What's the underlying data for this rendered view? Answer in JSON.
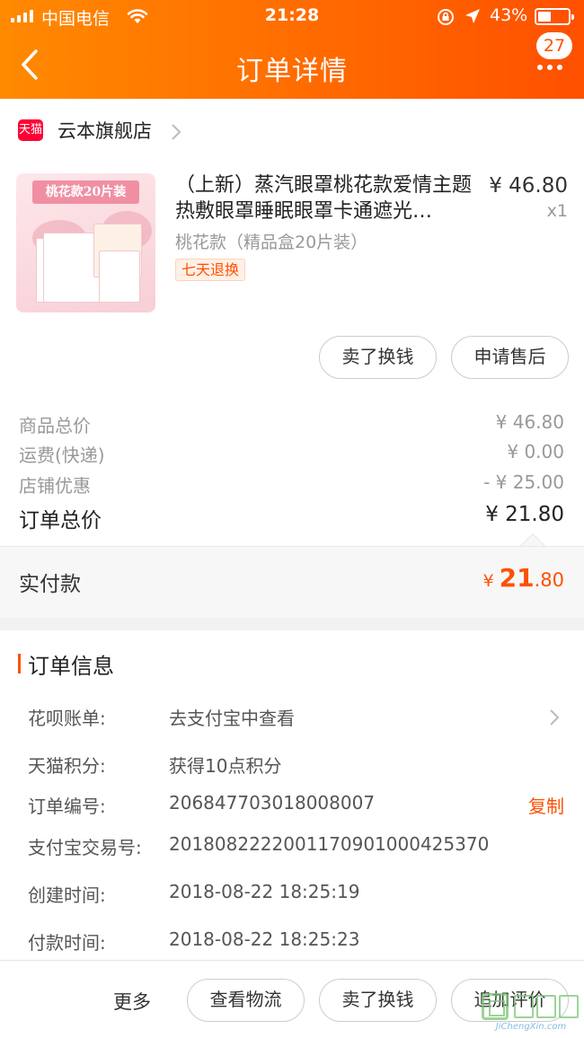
{
  "status_bar": {
    "carrier": "中国电信",
    "time": "21:28",
    "battery_pct": "43%",
    "battery_level": 0.43,
    "icons": [
      "signal-icon",
      "wifi-icon",
      "orientation-lock-icon",
      "location-arrow-icon",
      "battery-icon"
    ]
  },
  "nav": {
    "title": "订单详情",
    "badge": "27",
    "icons": [
      "back-chevron-icon",
      "more-dots-icon"
    ]
  },
  "colors": {
    "header_gradient": [
      "#ff8a00",
      "#ff5000"
    ],
    "accent": "#ff5000",
    "tmall_red": "#ff0036"
  },
  "store": {
    "badge": "天猫",
    "name": "云本旗舰店"
  },
  "product": {
    "image_banner": "桃花款20片装",
    "title": "（上新）蒸汽眼罩桃花款爱情主题热敷眼罩睡眠眼罩卡通遮光…",
    "price": "¥ 46.80",
    "qty": "x1",
    "sku": "桃花款（精品盒20片装）",
    "tag": "七天退换",
    "actions": [
      "卖了换钱",
      "申请售后"
    ]
  },
  "costs": [
    {
      "label": "商品总价",
      "value": "¥ 46.80"
    },
    {
      "label": "运费(快递)",
      "value": "¥ 0.00"
    },
    {
      "label": "店铺优惠",
      "value": "- ¥ 25.00"
    }
  ],
  "total": {
    "label": "订单总价",
    "value": "¥ 21.80"
  },
  "paid": {
    "label": "实付款",
    "currency": "¥ ",
    "integer": "21",
    "decimal": ".80"
  },
  "order_info": {
    "title": "订单信息",
    "rows": [
      {
        "key": "花呗账单:",
        "value": "去支付宝中查看"
      },
      {
        "key": "天猫积分:",
        "value": "获得10点积分"
      },
      {
        "key": "订单编号:",
        "value": "206847703018008007",
        "action": "复制"
      },
      {
        "key": "支付宝交易号:",
        "value": "2018082222001170901000425370"
      },
      {
        "key": "创建时间:",
        "value": "2018-08-22 18:25:19"
      },
      {
        "key": "付款时间:",
        "value": "2018-08-22 18:25:23"
      }
    ]
  },
  "bottom_bar": {
    "more": "更多",
    "buttons": [
      "查看物流",
      "卖了换钱",
      "追加评价"
    ]
  },
  "watermark": {
    "text": "JiChengXin.com"
  }
}
